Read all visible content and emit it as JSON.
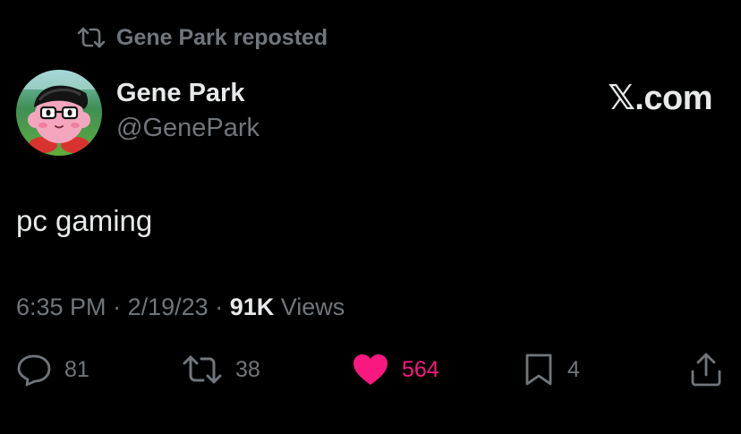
{
  "repost": {
    "icon": "repost-icon",
    "text": "Gene Park reposted"
  },
  "author": {
    "avatar_icon": "avatar-kirby",
    "display_name": "Gene Park",
    "handle": "@GenePark"
  },
  "brand": {
    "label": "𝕏.com"
  },
  "tweet": {
    "text": "pc gaming"
  },
  "meta": {
    "time": "6:35 PM",
    "separator": "·",
    "date": "2/19/23",
    "views_count": "91K",
    "views_label": "Views"
  },
  "actions": {
    "replies": {
      "icon": "reply-icon",
      "count": "81"
    },
    "reposts": {
      "icon": "repost-icon",
      "count": "38"
    },
    "likes": {
      "icon": "heart-icon",
      "count": "564",
      "liked": true
    },
    "bookmarks": {
      "icon": "bookmark-icon",
      "count": "4"
    },
    "share": {
      "icon": "share-icon"
    }
  },
  "colors": {
    "background": "#000000",
    "text_primary": "#e7e9ea",
    "text_secondary": "#71767b",
    "like_pink": "#f91880"
  }
}
